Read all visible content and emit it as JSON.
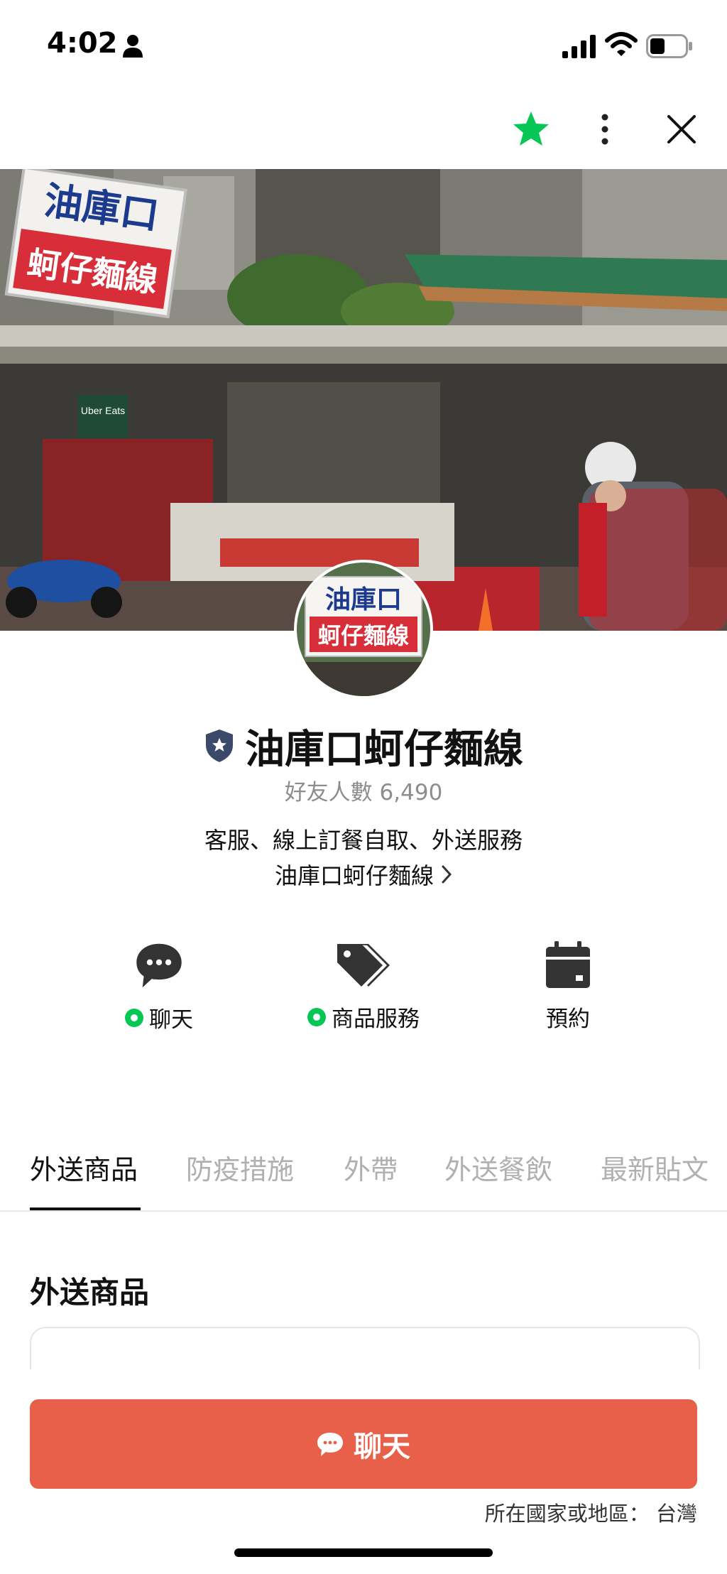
{
  "status_bar": {
    "time": "4:02"
  },
  "header": {
    "favorite_icon": "star-icon",
    "more_icon": "more-vertical-icon",
    "close_icon": "close-icon"
  },
  "cover": {
    "sign_line1": "油庫口",
    "sign_line2": "蚵仔麵線",
    "banner_text": "Uber Eats"
  },
  "avatar": {
    "sign_line1": "油庫口",
    "sign_line2": "蚵仔麵線"
  },
  "profile": {
    "name": "油庫口蚵仔麵線",
    "friends": "好友人數 6,490",
    "description": "客服、線上訂餐自取、外送服務",
    "shop_link": "油庫口蚵仔麵線"
  },
  "actions": [
    {
      "label": "聊天",
      "icon": "chat-bubble-icon",
      "online": true
    },
    {
      "label": "商品服務",
      "icon": "price-tag-icon",
      "online": true
    },
    {
      "label": "預約",
      "icon": "calendar-icon",
      "online": false
    }
  ],
  "tabs": [
    "外送商品",
    "防疫措施",
    "外帶",
    "外送餐飲",
    "最新貼文"
  ],
  "active_tab": "外送商品",
  "section": {
    "title": "外送商品"
  },
  "chat_button": {
    "label": "聊天"
  },
  "footer": {
    "region": "所在國家或地區： 台灣"
  },
  "colors": {
    "accent_green": "#06c755",
    "chat_button": "#e9604a"
  }
}
